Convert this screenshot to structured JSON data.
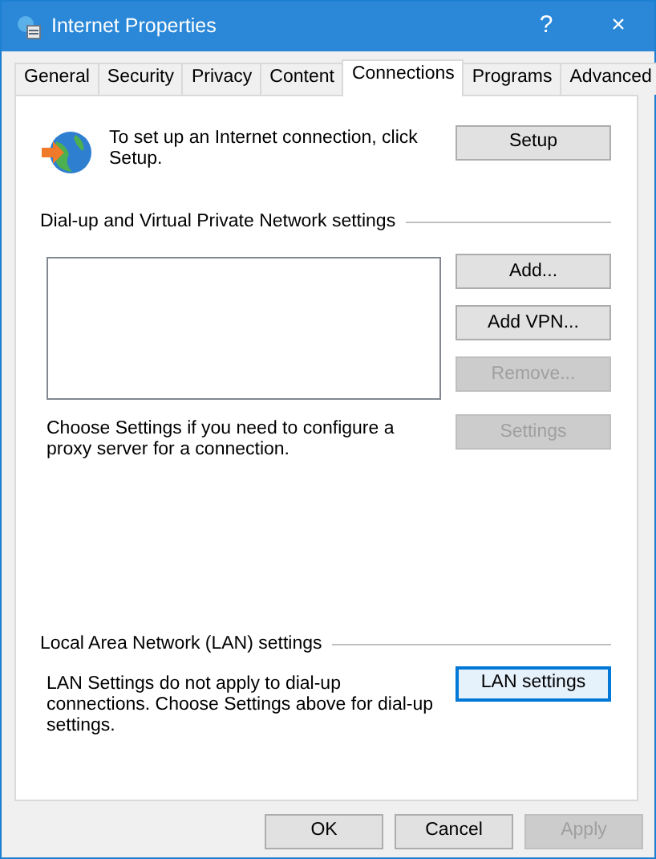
{
  "window": {
    "title": "Internet Properties",
    "help": "?",
    "close": "×"
  },
  "tabs": [
    {
      "label": "General",
      "selected": false
    },
    {
      "label": "Security",
      "selected": false
    },
    {
      "label": "Privacy",
      "selected": false
    },
    {
      "label": "Content",
      "selected": false
    },
    {
      "label": "Connections",
      "selected": true
    },
    {
      "label": "Programs",
      "selected": false
    },
    {
      "label": "Advanced",
      "selected": false
    }
  ],
  "setup": {
    "text": "To set up an Internet connection, click Setup.",
    "button": {
      "label": "Setup",
      "disabled": false,
      "focused": false
    }
  },
  "dialup": {
    "heading": "Dial-up and Virtual Private Network settings",
    "buttons": [
      {
        "label": "Add...",
        "disabled": false,
        "focused": false
      },
      {
        "label": "Add VPN...",
        "disabled": false,
        "focused": false
      },
      {
        "label": "Remove...",
        "disabled": true,
        "focused": false
      }
    ],
    "proxy_text": "Choose Settings if you need to configure a proxy server for a connection.",
    "settings_button": {
      "label": "Settings",
      "disabled": true,
      "focused": false
    }
  },
  "lan": {
    "heading": "Local Area Network (LAN) settings",
    "text": "LAN Settings do not apply to dial-up connections. Choose Settings above for dial-up settings.",
    "button": {
      "label": "LAN settings",
      "disabled": false,
      "focused": true
    }
  },
  "footer_buttons": [
    {
      "label": "OK",
      "disabled": false,
      "focused": false
    },
    {
      "label": "Cancel",
      "disabled": false,
      "focused": false
    },
    {
      "label": "Apply",
      "disabled": true,
      "focused": false
    }
  ]
}
